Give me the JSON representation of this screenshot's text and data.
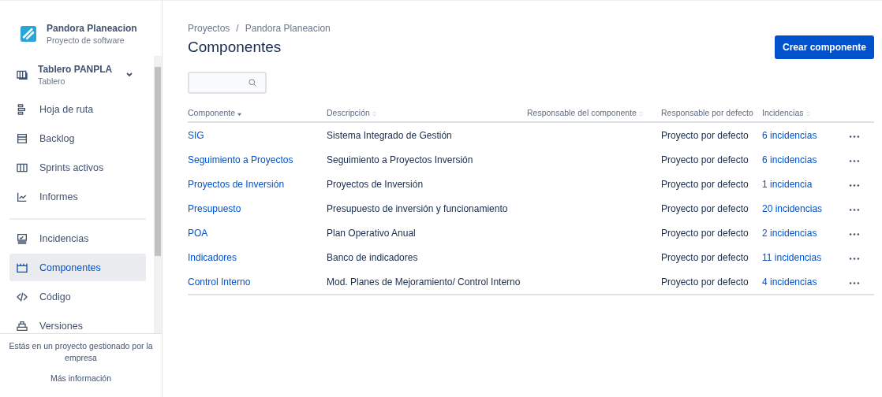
{
  "sidebar": {
    "project": {
      "name": "Pandora Planeacion",
      "type": "Proyecto de software"
    },
    "board": {
      "name": "Tablero PANPLA",
      "type": "Tablero"
    },
    "items": [
      {
        "label": "Hoja de ruta",
        "selected": false,
        "divider_before": false
      },
      {
        "label": "Backlog",
        "selected": false,
        "divider_before": false
      },
      {
        "label": "Sprints activos",
        "selected": false,
        "divider_before": false
      },
      {
        "label": "Informes",
        "selected": false,
        "divider_before": false
      },
      {
        "label": "Incidencias",
        "selected": false,
        "divider_before": true
      },
      {
        "label": "Componentes",
        "selected": true,
        "divider_before": false
      },
      {
        "label": "Código",
        "selected": false,
        "divider_before": false
      },
      {
        "label": "Versiones",
        "selected": false,
        "divider_before": false
      }
    ],
    "footer": {
      "text": "Estás en un proyecto gestionado por la empresa",
      "link": "Más información"
    }
  },
  "breadcrumbs": [
    "Proyectos",
    "Pandora Planeacion"
  ],
  "breadcrumb_separator": "/",
  "title": "Componentes",
  "create_button": "Crear componente",
  "table": {
    "columns": [
      {
        "label": "Componente",
        "sortable": true,
        "sorted": true
      },
      {
        "label": "Descripción",
        "sortable": true,
        "sorted": false
      },
      {
        "label": "Responsable del componente",
        "sortable": true,
        "sorted": false
      },
      {
        "label": "Responsable por defecto",
        "sortable": false
      },
      {
        "label": "Incidencias",
        "sortable": true,
        "sorted": false
      }
    ],
    "rows": [
      {
        "component": "SIG",
        "description": "Sistema Integrado de Gestión",
        "default": "Proyecto por defecto",
        "issues": "6 incidencias"
      },
      {
        "component": "Seguimiento a Proyectos",
        "description": "Seguimiento a Proyectos Inversión",
        "default": "Proyecto por defecto",
        "issues": "6 incidencias"
      },
      {
        "component": "Proyectos de Inversión",
        "description": "Proyectos de Inversión",
        "default": "Proyecto por defecto",
        "issues": "1 incidencia"
      },
      {
        "component": "Presupuesto",
        "description": "Presupuesto de inversión y funcionamiento",
        "default": "Proyecto por defecto",
        "issues": "20 incidencias"
      },
      {
        "component": "POA",
        "description": "Plan Operativo Anual",
        "default": "Proyecto por defecto",
        "issues": "2 incidencias"
      },
      {
        "component": "Indicadores",
        "description": "Banco de indicadores",
        "default": "Proyecto por defecto",
        "issues": "11 incidencias"
      },
      {
        "component": "Control Interno",
        "description": "Mod. Planes de Mejoramiento/ Control Interno",
        "default": "Proyecto por defecto",
        "issues": "4 incidencias"
      }
    ]
  }
}
